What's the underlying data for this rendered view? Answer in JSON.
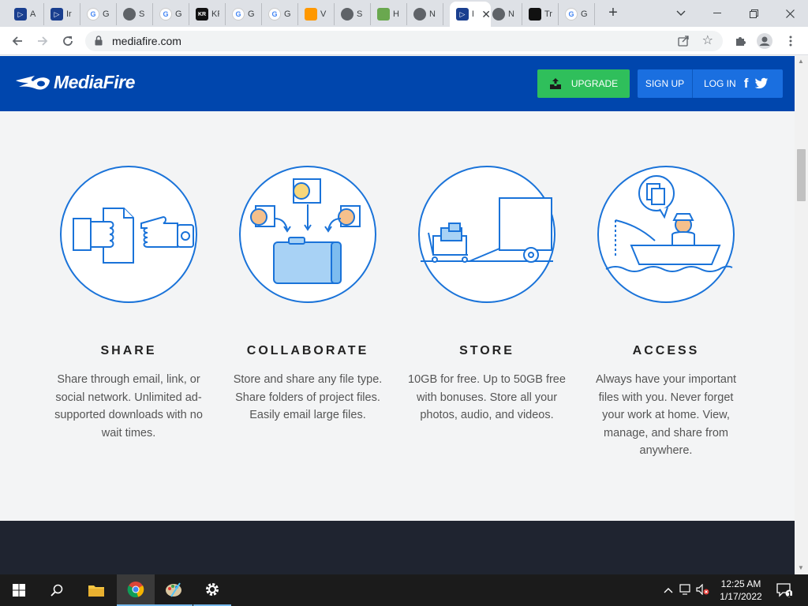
{
  "browser": {
    "tabs": [
      {
        "title": "A",
        "icon": "app-icon",
        "color": "#1a73e8"
      },
      {
        "title": "Ir",
        "icon": "app-icon",
        "color": "#1a73e8"
      },
      {
        "title": "G c",
        "icon": "google-icon",
        "color": "#ffffff"
      },
      {
        "title": "S",
        "icon": "globe-icon",
        "color": "#5f6368"
      },
      {
        "title": "G h",
        "icon": "google-icon",
        "color": "#ffffff"
      },
      {
        "title": "KR H",
        "icon": "kr-icon",
        "color": "#111111"
      },
      {
        "title": "G n",
        "icon": "google-icon",
        "color": "#ffffff"
      },
      {
        "title": "G le",
        "icon": "google-icon",
        "color": "#ffffff"
      },
      {
        "title": "V",
        "icon": "rainbow-icon",
        "color": "#ff9800"
      },
      {
        "title": "S",
        "icon": "globe-icon",
        "color": "#5f6368"
      },
      {
        "title": "H",
        "icon": "wiki-icon",
        "color": "#6aa84f"
      },
      {
        "title": "N",
        "icon": "globe-icon",
        "color": "#5f6368"
      },
      {
        "title": "Fi",
        "icon": "mediafire-icon",
        "color": "#1a73e8",
        "active": true
      },
      {
        "title": "N",
        "icon": "globe-icon",
        "color": "#5f6368"
      },
      {
        "title": "Tr",
        "icon": "v-icon",
        "color": "#111111"
      },
      {
        "title": "G m",
        "icon": "google-icon",
        "color": "#ffffff"
      }
    ],
    "new_tab": "+",
    "url": "mediafire.com"
  },
  "site": {
    "logo": "MediaFire",
    "upgrade_label": "UPGRADE",
    "signup_label": "SIGN UP",
    "login_label": "LOG IN",
    "facebook": "f",
    "brand_color": "#0046ad",
    "upgrade_color": "#2fbf5b"
  },
  "features": [
    {
      "title": "SHARE",
      "desc": "Share through email, link, or social network. Unlimited ad-supported downloads with no wait times.",
      "icon": "handshake-document-icon"
    },
    {
      "title": "COLLABORATE",
      "desc": "Store and share any file type. Share folders of project files. Easily email large files.",
      "icon": "people-folder-icon"
    },
    {
      "title": "STORE",
      "desc": "10GB for free. Up to 50GB free with bonuses. Store all your photos, audio, and videos.",
      "icon": "truck-storage-icon"
    },
    {
      "title": "ACCESS",
      "desc": "Always have your important files with you. Never forget your work at home. View, manage, and share from anywhere.",
      "icon": "fisherman-boat-icon"
    }
  ],
  "taskbar": {
    "time": "12:25 AM",
    "date": "1/17/2022",
    "notification_count": "1"
  }
}
